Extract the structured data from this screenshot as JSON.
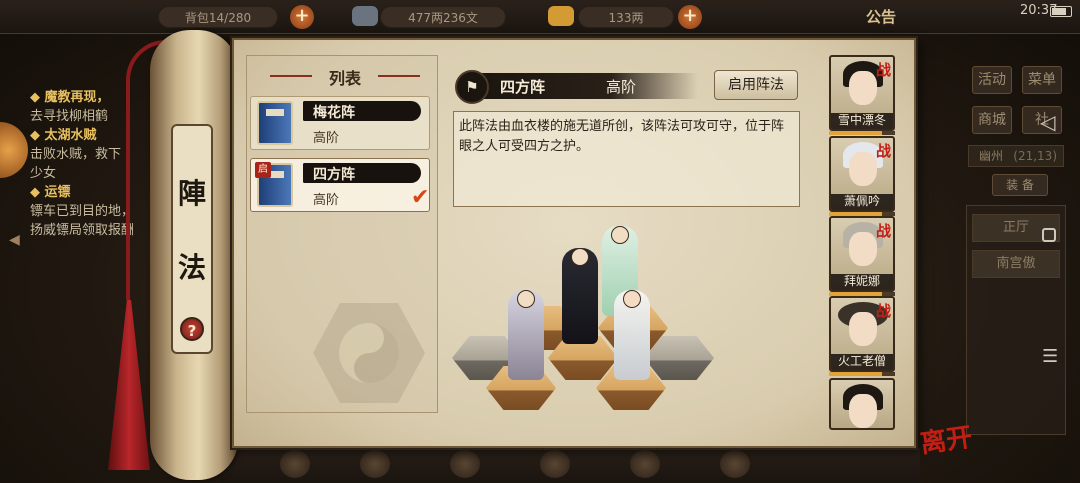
{
  "topbar": {
    "bag": "背包14/280",
    "copper": "477两236文",
    "silver": "133两",
    "announcement": "公告",
    "time": "20:37"
  },
  "quests": [
    {
      "title": "◆ 魔教再现，",
      "desc": "去寻找柳相鹤"
    },
    {
      "title": "◆ 太湖水贼",
      "desc": "击败水贼，救下"
    },
    {
      "title": "",
      "desc": "少女"
    },
    {
      "title": "◆ 运镖",
      "desc": "镖车已到目的地，"
    },
    {
      "title": "",
      "desc": "扬威镖局领取报酬"
    }
  ],
  "scroll": {
    "title_chars": [
      "陣",
      "法"
    ],
    "help": "?"
  },
  "list": {
    "title": "列表",
    "items": [
      {
        "name": "梅花阵",
        "grade": "高阶",
        "enabled": false,
        "selected": false
      },
      {
        "name": "四方阵",
        "grade": "高阶",
        "enabled": true,
        "selected": true,
        "badge": "启"
      }
    ]
  },
  "detail": {
    "name": "四方阵",
    "grade": "高阶",
    "enable_button": "启用阵法",
    "description": "此阵法由血衣楼的施无道所创，该阵法可攻可守，位于阵眼之人可受四方之护。"
  },
  "roster": [
    {
      "name": "雪中漂冬",
      "tag": "战"
    },
    {
      "name": "萧佩吟",
      "tag": "战"
    },
    {
      "name": "拜妮娜",
      "tag": "战"
    },
    {
      "name": "火工老僧",
      "tag": "战"
    },
    {
      "name": "",
      "tag": ""
    }
  ],
  "game_menu": {
    "buttons": [
      "活动",
      "菜单",
      "商城",
      "社"
    ],
    "location": "幽州",
    "coords": "(21,13)",
    "bag_tab": "装 备",
    "side_items": [
      "正厅",
      "南宫傲"
    ]
  },
  "bottom": {
    "leave": "离开"
  },
  "colors": {
    "accent_red": "#c21f14",
    "parchment": "#e6dcc4",
    "dark_bar": "#1b1510",
    "gold": "#e8c060"
  }
}
